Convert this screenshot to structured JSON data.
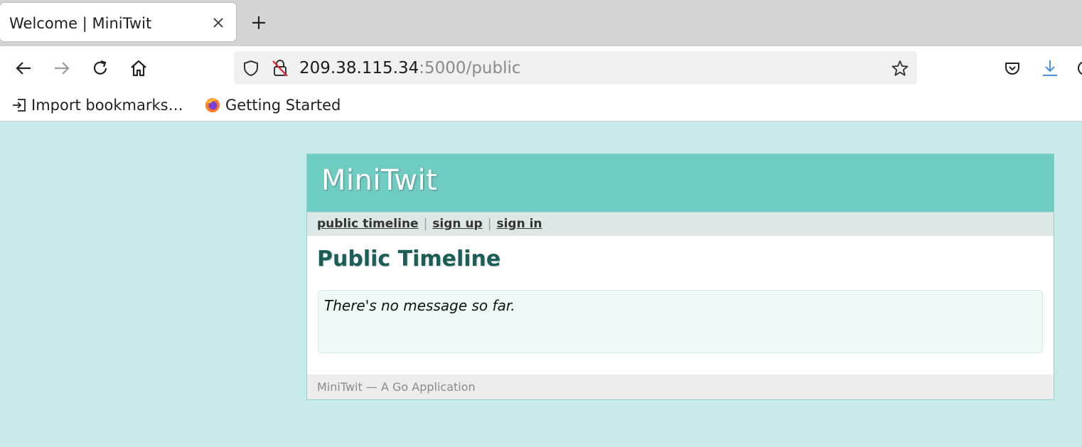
{
  "browser": {
    "tab_title": "Welcome | MiniTwit",
    "url_host": "209.38.115.34",
    "url_rest": ":5000/public",
    "bookmarks": [
      {
        "label": "Import bookmarks…",
        "icon": "import-icon"
      },
      {
        "label": "Getting Started",
        "icon": "firefox-icon"
      }
    ]
  },
  "app": {
    "name": "MiniTwit",
    "nav": [
      {
        "label": "public timeline"
      },
      {
        "label": "sign up"
      },
      {
        "label": "sign in"
      }
    ],
    "nav_separator": "|",
    "page_title": "Public Timeline",
    "empty_message": "There's no message so far.",
    "footer": "MiniTwit — A Go Application"
  },
  "colors": {
    "page_background": "#c8eae8",
    "header_background": "#6fccc3",
    "title_color": "#1b5e58"
  }
}
